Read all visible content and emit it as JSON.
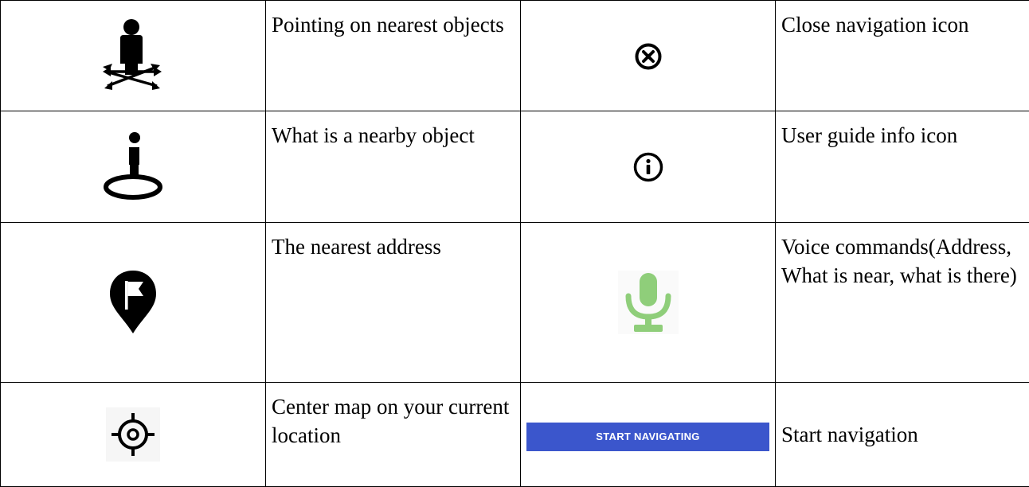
{
  "rows": [
    {
      "left_icon": "pointing-person-icon",
      "left_label": "Pointing on nearest objects",
      "right_icon": "close-circle-icon",
      "right_label": "Close navigation icon"
    },
    {
      "left_icon": "person-pin-circle-icon",
      "left_label": "What is a nearby object",
      "right_icon": "info-circle-icon",
      "right_label": "User guide info icon"
    },
    {
      "left_icon": "flag-pin-icon",
      "left_label": "The nearest address",
      "right_icon": "microphone-icon",
      "right_label": "Voice commands(Address, What is near, what is there)"
    },
    {
      "left_icon": "my-location-icon",
      "left_label": "Center map on your current location",
      "right_button": "START NAVIGATING",
      "right_label": "Start navigation"
    }
  ],
  "colors": {
    "mic_green": "#8fce7a",
    "button_blue": "#3b56cc"
  }
}
